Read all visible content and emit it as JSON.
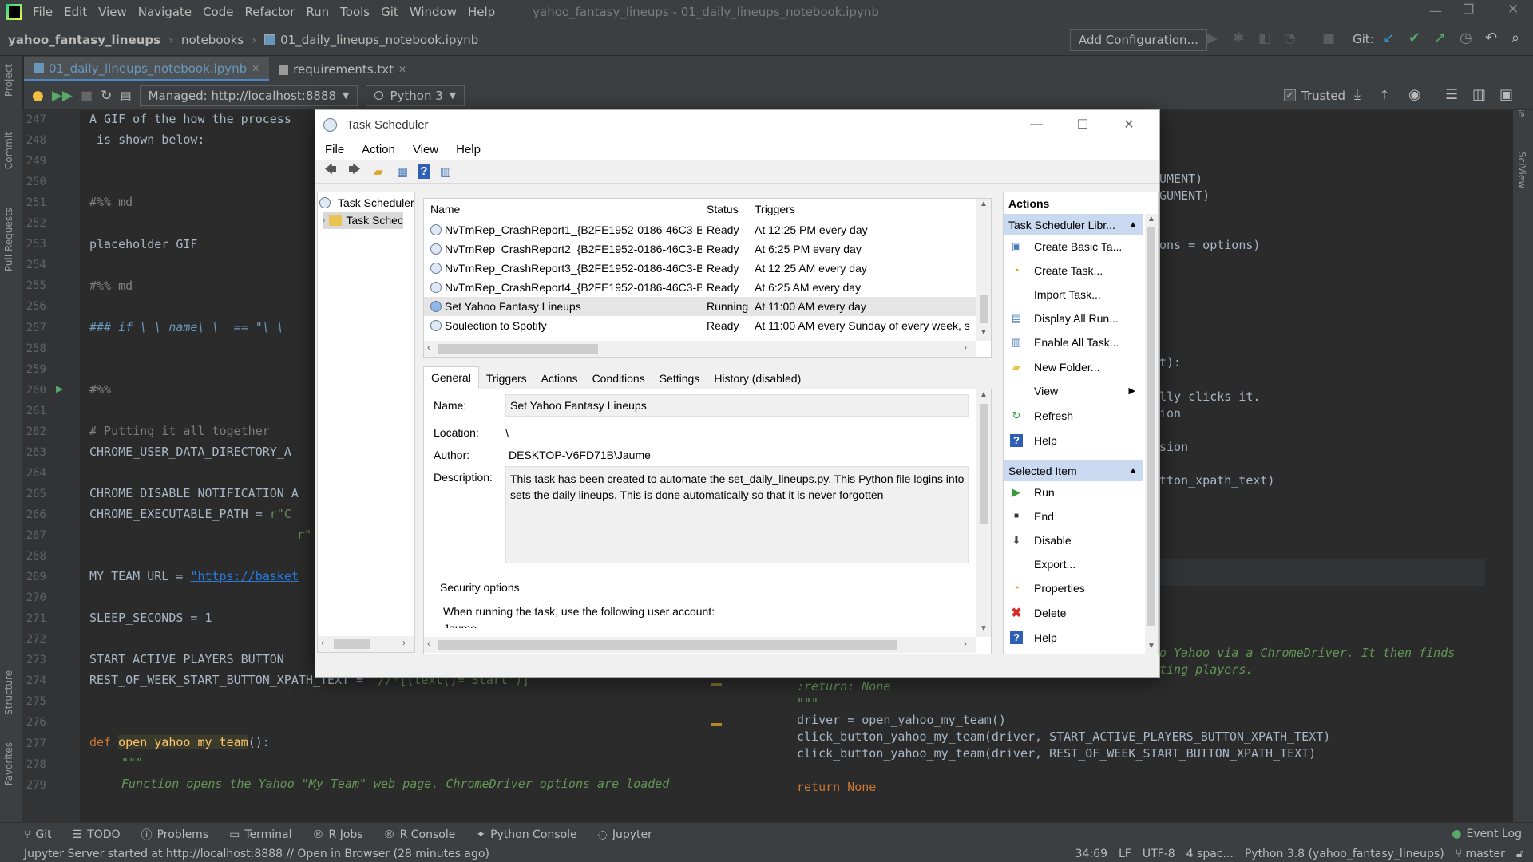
{
  "ide": {
    "menu": [
      "File",
      "Edit",
      "View",
      "Navigate",
      "Code",
      "Refactor",
      "Run",
      "Tools",
      "Git",
      "Window",
      "Help"
    ],
    "window_title": "yahoo_fantasy_lineups - 01_daily_lineups_notebook.ipynb",
    "breadcrumbs": [
      "yahoo_fantasy_lineups",
      "notebooks",
      "01_daily_lineups_notebook.ipynb"
    ],
    "add_configuration": "Add Configuration...",
    "git_label": "Git:",
    "tabs": [
      "01_daily_lineups_notebook.ipynb",
      "requirements.txt"
    ],
    "managed_server": "Managed: http://localhost:8888",
    "kernel": "Python 3",
    "trusted": "Trusted",
    "left_tools": [
      "Project",
      "Commit",
      "Pull Requests",
      "Structure",
      "Favorites"
    ],
    "right_tools": [
      "Database",
      "SciView"
    ],
    "line_numbers": [
      "247",
      "248",
      "249",
      "250",
      "251",
      "252",
      "253",
      "254",
      "255",
      "256",
      "257",
      "258",
      "259",
      "260",
      "261",
      "262",
      "263",
      "264",
      "265",
      "266",
      "267",
      "268",
      "269",
      "270",
      "271",
      "272",
      "273",
      "274",
      "275",
      "276",
      "277",
      "278",
      "279"
    ],
    "code_left": {
      "l247": "A GIF of the how the process",
      "l248": " is shown below:",
      "l251": "#%% md",
      "l253": "placeholder GIF",
      "l255": "#%% md",
      "l257": "### if \\_\\_name\\_\\_ == \"\\_\\_",
      "l260": "#%%",
      "l262": "# Putting it all together",
      "l263": "CHROME_USER_DATA_DIRECTORY_A",
      "l265": "CHROME_DISABLE_NOTIFICATION_A",
      "l266": "CHROME_EXECUTABLE_PATH = ",
      "l266s": "r\"C",
      "l267s": "r\"",
      "l269": "MY_TEAM_URL = ",
      "l269s": "\"https://basket",
      "l271": "SLEEP_SECONDS = 1",
      "l273": "START_ACTIVE_PLAYERS_BUTTON_",
      "l274": "REST_OF_WEEK_START_BUTTON_XPATH_TEXT = ",
      "l274s": "\"//*[(text()='Start')]\"",
      "l277kw": "def ",
      "l277fn": "open_yahoo_my_team",
      "l277": "():",
      "l278": "\"\"\"",
      "l279": "Function opens the Yahoo \"My Team\" web page. ChromeDriver options are loaded"
    },
    "code_right": {
      "r1": "UMENT)",
      "r2": "GUMENT)",
      "r3": "ons = options)",
      "r4": "t):",
      "r5": "lly clicks it.",
      "r6": "ion",
      "r7": "sion",
      "r8": "tton_xpath_text)",
      "r9": "o Yahoo via a ChromeDriver. It then finds",
      "r10": "ting players.",
      "r11": ":return: None",
      "r12": "\"\"\"",
      "r13": "driver = open_yahoo_my_team()",
      "r14": "click_button_yahoo_my_team(driver, START_ACTIVE_PLAYERS_BUTTON_XPATH_TEXT)",
      "r15": "click_button_yahoo_my_team(driver, REST_OF_WEEK_START_BUTTON_XPATH_TEXT)",
      "r16": "return None"
    },
    "tool_windows": [
      "Git",
      "TODO",
      "Problems",
      "Terminal",
      "R Jobs",
      "R Console",
      "Python Console",
      "Jupyter"
    ],
    "event_log": "Event Log",
    "status": "Jupyter Server started at http://localhost:8888 // Open in Browser (28 minutes ago)",
    "status_right": [
      "34:69",
      "LF",
      "UTF-8",
      "4 spac...",
      "Python 3.8 (yahoo_fantasy_lineups)",
      "master"
    ]
  },
  "task_scheduler": {
    "title": "Task Scheduler",
    "menu": [
      "File",
      "Action",
      "View",
      "Help"
    ],
    "tree": [
      "Task Scheduler",
      "Task Schec"
    ],
    "columns": [
      "Name",
      "Status",
      "Triggers"
    ],
    "tasks": [
      {
        "name": "NvTmRep_CrashReport1_{B2FE1952-0186-46C3-B...",
        "status": "Ready",
        "trigger": "At 12:25 PM every day"
      },
      {
        "name": "NvTmRep_CrashReport2_{B2FE1952-0186-46C3-B...",
        "status": "Ready",
        "trigger": "At 6:25 PM every day"
      },
      {
        "name": "NvTmRep_CrashReport3_{B2FE1952-0186-46C3-B...",
        "status": "Ready",
        "trigger": "At 12:25 AM every day"
      },
      {
        "name": "NvTmRep_CrashReport4_{B2FE1952-0186-46C3-B...",
        "status": "Ready",
        "trigger": "At 6:25 AM every day"
      },
      {
        "name": "Set Yahoo Fantasy Lineups",
        "status": "Running",
        "trigger": "At 11:00 AM every day"
      },
      {
        "name": "Soulection to Spotify",
        "status": "Ready",
        "trigger": "At 11:00 AM every Sunday of every week, s"
      }
    ],
    "detail_tabs": [
      "General",
      "Triggers",
      "Actions",
      "Conditions",
      "Settings",
      "History (disabled)"
    ],
    "labels": {
      "name": "Name:",
      "location": "Location:",
      "author": "Author:",
      "description": "Description:"
    },
    "name": "Set Yahoo Fantasy Lineups",
    "location": "\\",
    "author": "DESKTOP-V6FD71B\\Jaume",
    "description_1": "This task has been created to automate the set_daily_lineups.py. This Python file logins into",
    "description_2": "sets the daily lineups. This is done automatically so that it is never forgotten",
    "security_options": "Security options",
    "run_as_text": "When running the task, use the following user account:",
    "run_as_user": "Jaume",
    "actions_header": "Actions",
    "library_section": "Task Scheduler Libr...",
    "library_actions": [
      "Create Basic Ta...",
      "Create Task...",
      "Import Task...",
      "Display All Run...",
      "Enable All Task...",
      "New Folder...",
      "View",
      "Refresh",
      "Help"
    ],
    "selected_section": "Selected Item",
    "selected_actions": [
      "Run",
      "End",
      "Disable",
      "Export...",
      "Properties",
      "Delete",
      "Help"
    ]
  }
}
